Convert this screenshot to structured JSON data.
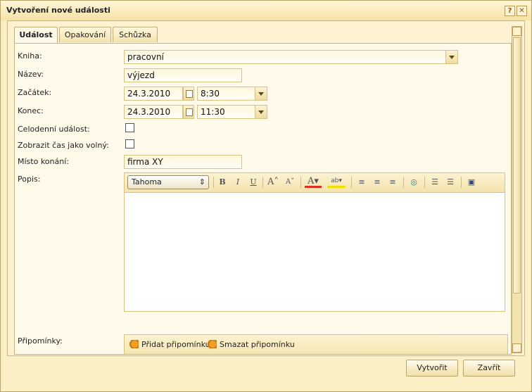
{
  "window": {
    "title": "Vytvoření nové události"
  },
  "tabs": [
    {
      "label": "Událost"
    },
    {
      "label": "Opakování"
    },
    {
      "label": "Schůzka"
    }
  ],
  "form": {
    "book_label": "Kniha:",
    "book_value": "pracovní",
    "name_label": "Název:",
    "name_value": "výjezd",
    "start_label": "Začátek:",
    "start_date": "24.3.2010",
    "start_time": "8:30",
    "end_label": "Konec:",
    "end_date": "24.3.2010",
    "end_time": "11:30",
    "allday_label": "Celodenní událost:",
    "allday_checked": false,
    "free_label": "Zobrazit čas jako volný:",
    "free_checked": false,
    "place_label": "Místo konání:",
    "place_value": "firma XY",
    "desc_label": "Popis:",
    "reminders_label": "Připomínky:"
  },
  "editor": {
    "font": "Tahoma",
    "tools": [
      "bold-icon",
      "italic-icon",
      "underline-icon",
      "grow-font-icon",
      "shrink-font-icon",
      "font-color-icon",
      "highlight-icon",
      "align-left-icon",
      "align-center-icon",
      "align-right-icon",
      "link-icon",
      "ordered-list-icon",
      "unordered-list-icon",
      "source-edit-icon"
    ]
  },
  "reminders": {
    "add_label": "Přidat připomínku",
    "delete_label": "Smazat připomínku"
  },
  "buttons": {
    "create": "Vytvořit",
    "close": "Zavřít"
  },
  "colors": {
    "window_bg": "#fbefc5",
    "accent_border": "#b9a46a",
    "font_color_bar": "#e03020",
    "highlight_bar": "#f0e000"
  }
}
